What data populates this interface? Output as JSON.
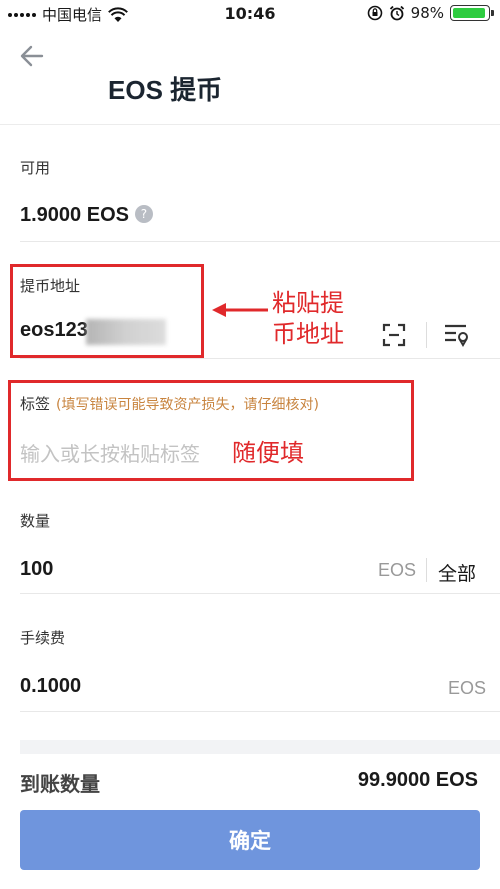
{
  "status_bar": {
    "carrier": "中国电信",
    "time": "10:46",
    "battery": "98%"
  },
  "header": {
    "title": "EOS 提币"
  },
  "available": {
    "label": "可用",
    "value": "1.9000 EOS",
    "help": "?"
  },
  "address": {
    "label": "提币地址",
    "value": "eos123",
    "annotation_line1": "粘贴提",
    "annotation_line2": "币地址"
  },
  "memo": {
    "label": "标签",
    "hint": "(填写错误可能导致资产损失，请仔细核对)",
    "placeholder": "输入或长按粘贴标签",
    "annotation": "随便填"
  },
  "amount": {
    "label": "数量",
    "value": "100",
    "unit": "EOS",
    "all": "全部"
  },
  "fee": {
    "label": "手续费",
    "value": "0.1000",
    "unit": "EOS"
  },
  "receive": {
    "label": "到账数量",
    "value": "99.9000 EOS"
  },
  "confirm_label": "确定",
  "colors": {
    "accent_red": "#e0292b",
    "button_blue": "#6f95dd",
    "battery_green": "#2ecc40"
  },
  "icons": [
    "back-arrow-icon",
    "scan-icon",
    "address-book-icon",
    "help-icon",
    "wifi-icon",
    "alarm-icon",
    "lock-rotation-icon"
  ]
}
